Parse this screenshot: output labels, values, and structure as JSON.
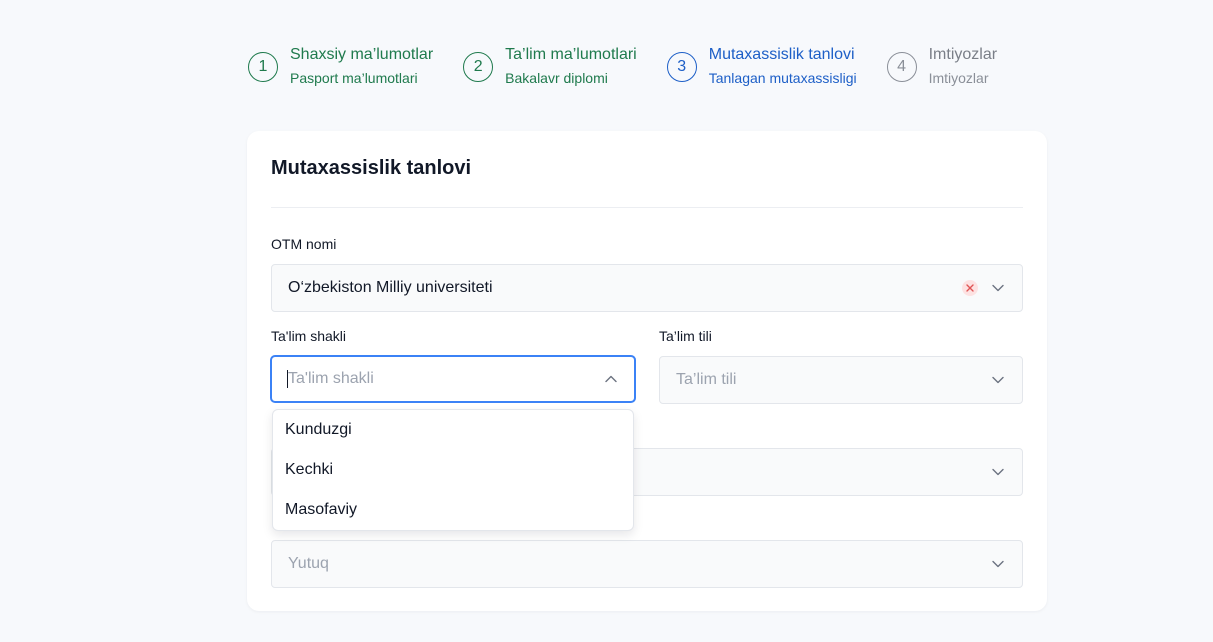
{
  "stepper": {
    "steps": [
      {
        "number": "1",
        "title": "Shaxsiy ma’lumotlar",
        "subtitle": "Pasport ma’lumotlari",
        "state": "done"
      },
      {
        "number": "2",
        "title": "Ta’lim ma’lumotlari",
        "subtitle": "Bakalavr diplomi",
        "state": "done"
      },
      {
        "number": "3",
        "title": "Mutaxassislik tanlovi",
        "subtitle": "Tanlagan mutaxassisligi",
        "state": "active"
      },
      {
        "number": "4",
        "title": "Imtiyozlar",
        "subtitle": "Imtiyozlar",
        "state": "todo"
      }
    ]
  },
  "form": {
    "title": "Mutaxassislik tanlovi",
    "otm": {
      "label": "OTM nomi",
      "value": "O‘zbekiston Milliy universiteti"
    },
    "talim_shakli": {
      "label": "Ta'lim shakli",
      "placeholder": "Ta'lim shakli",
      "options": [
        "Kunduzgi",
        "Kechki",
        "Masofaviy"
      ]
    },
    "talim_tili": {
      "label": "Ta’lim tili",
      "placeholder": "Ta’lim tili"
    },
    "yutuq": {
      "placeholder": "Yutuq"
    }
  },
  "colors": {
    "done": "#1f7a4d",
    "active": "#1d5fc7",
    "todo": "#8a8f98",
    "focus_border": "#3b82f6",
    "clear_bg": "#fde2e2",
    "clear_icon": "#e05555"
  }
}
